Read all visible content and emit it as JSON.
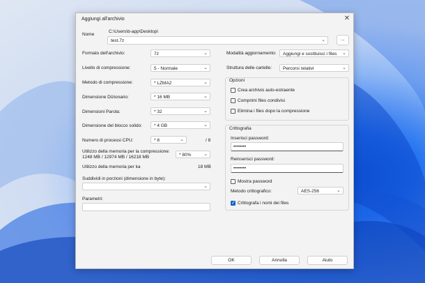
{
  "window": {
    "title": "Aggiungi all'archivio"
  },
  "icons": {
    "close": "close-icon",
    "chevron": "chevron-down-icon"
  },
  "name": {
    "label": "Nome",
    "path": "C:\\Users\\b-app\\Desktop\\",
    "value": "test.7z",
    "browse_label": "..."
  },
  "left": {
    "format_label": "Formato dell'archivio:",
    "format_value": "7z",
    "level_label": "Livello di compressione:",
    "level_value": "5 - Normale",
    "method_label": "Metodo di compressione:",
    "method_value": "* LZMA2",
    "dict_label": "Dimensione Dizionario:",
    "dict_value": "* 16 MB",
    "word_label": "Dimensioni Parola:",
    "word_value": "* 32",
    "block_label": "Dimensione del blocco solido:",
    "block_value": "* 4 GB",
    "cpu_label": "Numero di processi CPU:",
    "cpu_value": "* 8",
    "cpu_total": "/ 8",
    "mem_comp_label": "Utilizzo della memoria per la compressione:",
    "mem_comp_detail": "1248 MB / 12974 MB / 16218 MB",
    "mem_comp_value": "* 80%",
    "mem_decomp_label": "Utilizzo della memoria per ka",
    "mem_decomp_value": "18 MB",
    "split_label": "Suddividi in porzioni (dimensione in byte):",
    "split_value": "",
    "params_label": "Parametri:",
    "params_value": ""
  },
  "right": {
    "update_label": "Modalità aggiornamento:",
    "update_value": "Aggiungi e sostituisci i files",
    "paths_label": "Struttura delle cartelle:",
    "paths_value": "Percorsi relativi",
    "options_title": "Opzioni",
    "opt_sfx": "Crea archivio auto-estraente",
    "opt_shared": "Comprimi files condivisi",
    "opt_delete": "Elimina i files dopo la compressione",
    "crypto_title": "Crittografia",
    "pwd_label": "Inserisci password:",
    "pwd_value": "••••••••",
    "pwd2_label": "Reinserisci password:",
    "pwd2_value": "••••••••",
    "show_pwd": "Mostra password",
    "method_label": "Metodo crittografico:",
    "method_value": "AES-256",
    "encrypt_names": "Crittografa i nomi dei files"
  },
  "buttons": {
    "ok": "OK",
    "cancel": "Annulla",
    "help": "Aiuto"
  }
}
